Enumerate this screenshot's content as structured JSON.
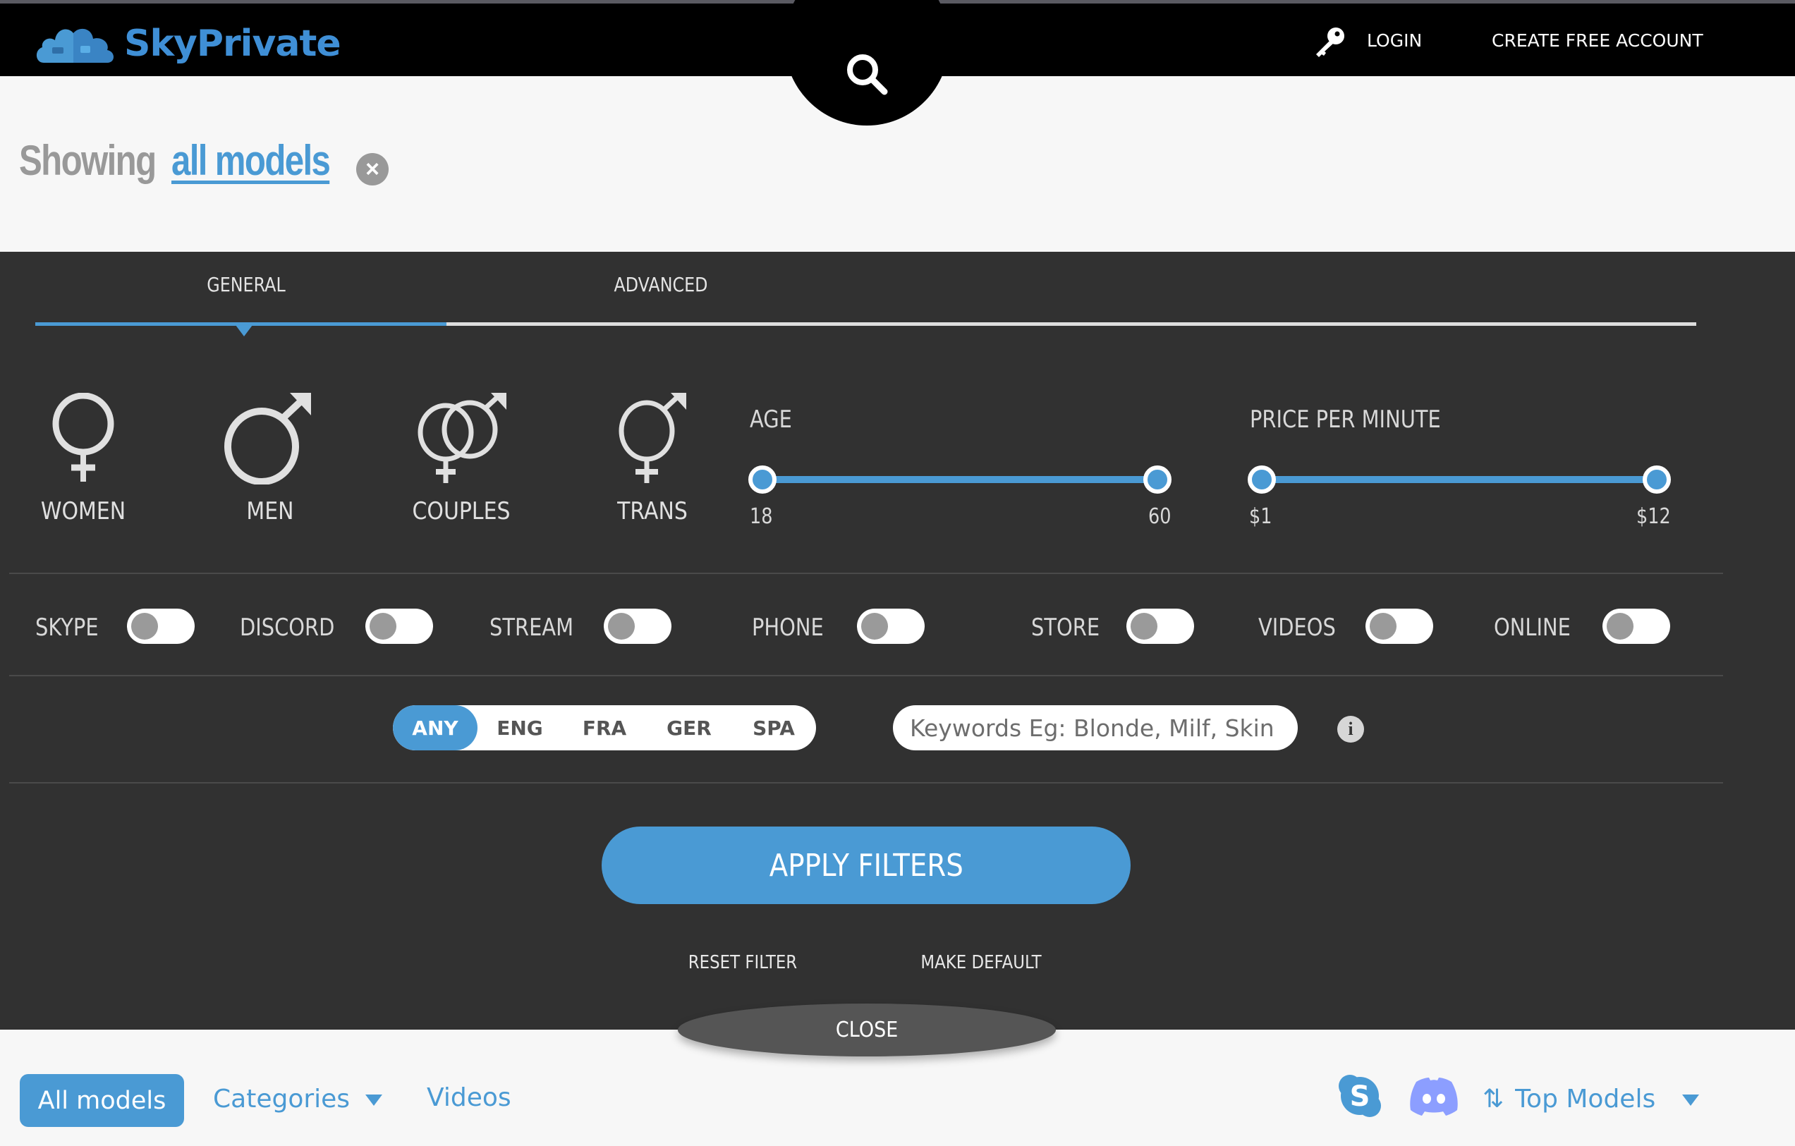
{
  "header": {
    "brand": "SkyPrivate",
    "login_label": "LOGIN",
    "create_account_label": "CREATE FREE ACCOUNT",
    "icons": {
      "logo": "cloud-logo-icon",
      "search": "search-icon",
      "key": "key-icon"
    }
  },
  "showing": {
    "label": "Showing",
    "filter_link": "all models",
    "clear_icon": "close-circle-icon"
  },
  "filters": {
    "tabs": [
      {
        "label": "GENERAL",
        "active": true
      },
      {
        "label": "ADVANCED",
        "active": false
      }
    ],
    "genders": [
      {
        "label": "WOMEN",
        "icon": "female-symbol-icon"
      },
      {
        "label": "MEN",
        "icon": "male-symbol-icon"
      },
      {
        "label": "COUPLES",
        "icon": "couple-symbol-icon"
      },
      {
        "label": "TRANS",
        "icon": "transgender-symbol-icon"
      }
    ],
    "age": {
      "title": "AGE",
      "min_label": "18",
      "max_label": "60",
      "min": 18,
      "max": 60
    },
    "price": {
      "title": "PRICE PER MINUTE",
      "min_label": "$1",
      "max_label": "$12",
      "min": 1,
      "max": 12
    },
    "toggles": [
      {
        "label": "SKYPE",
        "on": false
      },
      {
        "label": "DISCORD",
        "on": false
      },
      {
        "label": "STREAM",
        "on": false
      },
      {
        "label": "PHONE",
        "on": false
      },
      {
        "label": "STORE",
        "on": false
      },
      {
        "label": "VIDEOS",
        "on": false
      },
      {
        "label": "ONLINE",
        "on": false
      }
    ],
    "languages": [
      {
        "label": "ANY",
        "active": true
      },
      {
        "label": "ENG",
        "active": false
      },
      {
        "label": "FRA",
        "active": false
      },
      {
        "label": "GER",
        "active": false
      },
      {
        "label": "SPA",
        "active": false
      }
    ],
    "keywords": {
      "value": "",
      "placeholder": "Keywords Eg: Blonde, Milf, Skin"
    },
    "info_icon": "info-icon",
    "apply_label": "APPLY FILTERS",
    "reset_label": "RESET FILTER",
    "make_default_label": "MAKE DEFAULT",
    "close_label": "CLOSE"
  },
  "bottom_nav": {
    "all_models_label": "All models",
    "categories_label": "Categories",
    "videos_label": "Videos",
    "sort_label": "Top Models",
    "icons": {
      "skype": "skype-icon",
      "discord": "discord-icon",
      "sort": "sort-arrows-icon",
      "dropdown": "caret-down-icon"
    }
  },
  "colors": {
    "accent": "#4a9ad4",
    "panel_bg": "#313131",
    "header_bg": "#000000",
    "discord": "#8c9eff"
  }
}
